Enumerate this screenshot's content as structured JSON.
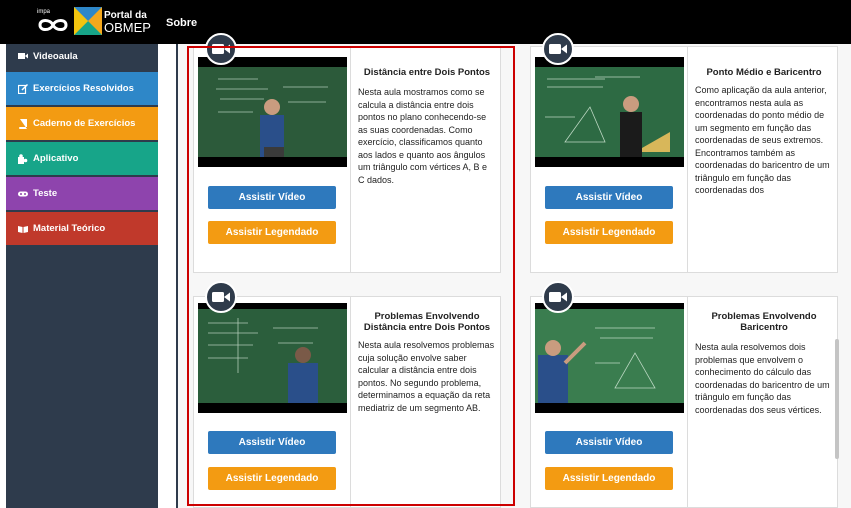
{
  "header": {
    "logo_impa": "impa",
    "logo_portal": "Portal da",
    "logo_obmep": "OBMEP",
    "nav_sobre": "Sobre"
  },
  "sidebar": {
    "items": [
      {
        "label": "Videoaula",
        "color": "#2e3b4c",
        "icon": "video-icon"
      },
      {
        "label": "Exercícios Resolvidos",
        "color": "#2e87c8",
        "icon": "edit-icon"
      },
      {
        "label": "Caderno de Exercícios",
        "color": "#f39b12",
        "icon": "book-icon"
      },
      {
        "label": "Aplicativo",
        "color": "#17a589",
        "icon": "puzzle-icon"
      },
      {
        "label": "Teste",
        "color": "#8e44ad",
        "icon": "gamepad-icon"
      },
      {
        "label": "Material Teórico",
        "color": "#c0392b",
        "icon": "open-book-icon"
      }
    ]
  },
  "buttons": {
    "watch": "Assistir Vídeo",
    "subtitled": "Assistir Legendado",
    "blue": "#2e79bd",
    "orange": "#f39b12"
  },
  "cards": [
    {
      "title": "Distância entre Dois Pontos",
      "description": "Nesta aula mostramos como se calcula a distância entre dois pontos no plano conhecendo-se as suas coordenadas. Como exercício, classificamos quanto aos lados e quanto aos ângulos um triângulo com vértices A, B e C dados."
    },
    {
      "title": "Ponto Médio e Baricentro",
      "description": "Como aplicação da aula anterior, encontramos nesta aula as coordenadas do ponto médio de um segmento em função das coordenadas de seus extremos. Encontramos também as coordenadas do baricentro de um triângulo em função das coordenadas dos"
    },
    {
      "title": "Problemas Envolvendo Distância entre Dois Pontos",
      "description": "Nesta aula resolvemos problemas cuja solução envolve saber calcular a distância entre dois pontos. No segundo problema, determinamos a equação da reta mediatriz de um segmento AB."
    },
    {
      "title": "Problemas Envolvendo Baricentro",
      "description": "Nesta aula resolvemos dois problemas que envolvem o conhecimento do cálculo das coordenadas do baricentro de um triângulo em função das coordenadas dos seus vértices."
    }
  ]
}
